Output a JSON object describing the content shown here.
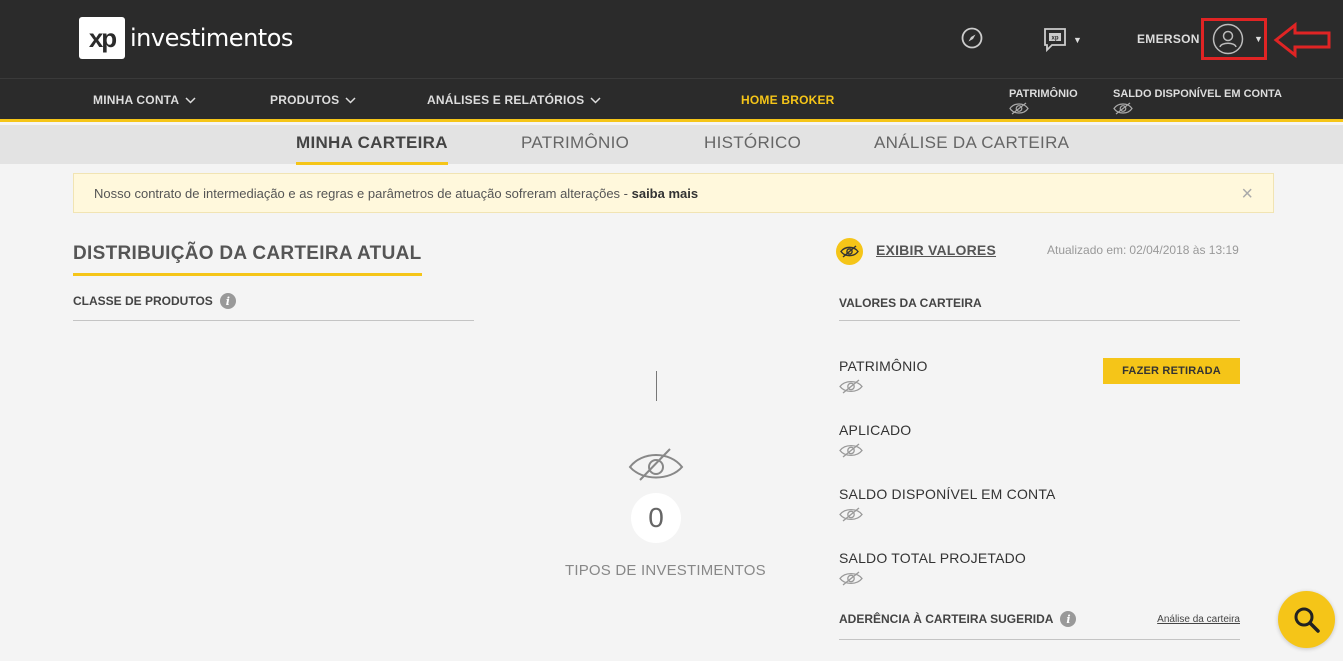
{
  "header": {
    "logo_mark": "xp",
    "logo_text": "investimentos",
    "username": "EMERSON"
  },
  "nav": {
    "minha_conta": "MINHA CONTA",
    "produtos": "PRODUTOS",
    "analises": "ANÁLISES E RELATÓRIOS",
    "home_broker": "HOME BROKER",
    "patrimonio": "PATRIMÔNIO",
    "saldo": "SALDO DISPONÍVEL EM CONTA"
  },
  "tabs": [
    {
      "label": "MINHA CARTEIRA",
      "active": true
    },
    {
      "label": "PATRIMÔNIO",
      "active": false
    },
    {
      "label": "HISTÓRICO",
      "active": false
    },
    {
      "label": "ANÁLISE DA CARTEIRA",
      "active": false
    }
  ],
  "alert": {
    "text": "Nosso contrato de intermediação e as regras e parâmetros de atuação sofreram alterações - ",
    "link": "saiba mais",
    "close": "×"
  },
  "left": {
    "title": "DISTRIBUIÇÃO DA CARTEIRA ATUAL",
    "class_label": "CLASSE DE PRODUTOS",
    "count": "0",
    "count_label": "TIPOS DE INVESTIMENTOS"
  },
  "right": {
    "exibir": "EXIBIR VALORES",
    "updated_label": "Atualizado em:",
    "updated_value": "02/04/2018 às 13:19",
    "valores_label": "VALORES DA CARTEIRA",
    "rows": [
      {
        "label": "PATRIMÔNIO"
      },
      {
        "label": "APLICADO"
      },
      {
        "label": "SALDO DISPONÍVEL EM CONTA"
      },
      {
        "label": "SALDO TOTAL PROJETADO"
      }
    ],
    "retirada_button": "FAZER RETIRADA",
    "aderencia": "ADERÊNCIA À CARTEIRA SUGERIDA",
    "analise_link": "Análise da carteira"
  },
  "colors": {
    "accent": "#f5c518",
    "dark": "#2b2b2b",
    "highlight": "#e02424"
  }
}
